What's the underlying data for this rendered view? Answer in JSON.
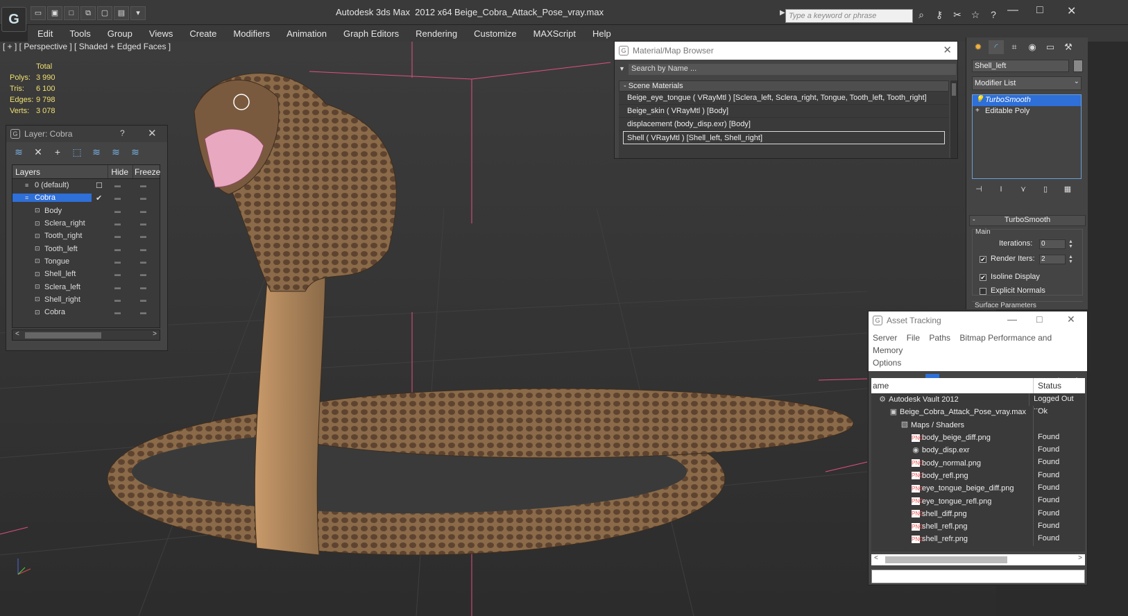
{
  "titlebar": {
    "app_title": "Autodesk 3ds Max  2012 x64",
    "file_name": "Beige_Cobra_Attack_Pose_vray.max",
    "search_placeholder": "Type a keyword or phrase",
    "logo_glyph": "G"
  },
  "menu": [
    "Edit",
    "Tools",
    "Group",
    "Views",
    "Create",
    "Modifiers",
    "Animation",
    "Graph Editors",
    "Rendering",
    "Customize",
    "MAXScript",
    "Help"
  ],
  "viewport": {
    "label": "[ + ] [ Perspective ] [ Shaded + Edged Faces ]",
    "stats_header": "Total",
    "stats": [
      {
        "k": "Polys:",
        "v": "3 990"
      },
      {
        "k": "Tris:",
        "v": "6 100"
      },
      {
        "k": "Edges:",
        "v": "9 798"
      },
      {
        "k": "Verts:",
        "v": "3 078"
      }
    ]
  },
  "layer_window": {
    "title": "Layer: Cobra",
    "help": "?",
    "close": "✕",
    "col_layers": "Layers",
    "col_hide": "Hide",
    "col_freeze": "Freeze",
    "rows": [
      {
        "name": "0 (default)",
        "indent": 0,
        "selected": false,
        "check": "☐"
      },
      {
        "name": "Cobra",
        "indent": 0,
        "selected": true,
        "check": "✔"
      },
      {
        "name": "Body",
        "indent": 1,
        "selected": false,
        "check": ""
      },
      {
        "name": "Sclera_right",
        "indent": 1,
        "selected": false,
        "check": ""
      },
      {
        "name": "Tooth_right",
        "indent": 1,
        "selected": false,
        "check": ""
      },
      {
        "name": "Tooth_left",
        "indent": 1,
        "selected": false,
        "check": ""
      },
      {
        "name": "Tongue",
        "indent": 1,
        "selected": false,
        "check": ""
      },
      {
        "name": "Shell_left",
        "indent": 1,
        "selected": false,
        "check": ""
      },
      {
        "name": "Sclera_left",
        "indent": 1,
        "selected": false,
        "check": ""
      },
      {
        "name": "Shell_right",
        "indent": 1,
        "selected": false,
        "check": ""
      },
      {
        "name": "Cobra",
        "indent": 1,
        "selected": false,
        "check": ""
      }
    ]
  },
  "material_browser": {
    "title": "Material/Map Browser",
    "search": "Search by Name ...",
    "group": "- Scene Materials",
    "items": [
      "Beige_eye_tongue  ( VRayMtl ) [Sclera_left, Sclera_right, Tongue, Tooth_left, Tooth_right]",
      "Beige_skin  ( VRayMtl ) [Body]",
      "displacement (body_disp.exr) [Body]",
      "Shell  ( VRayMtl ) [Shell_left, Shell_right]"
    ],
    "selected_index": 3
  },
  "command_panel": {
    "object_name": "Shell_left",
    "modifier_list": "Modifier List",
    "stack": [
      {
        "label": "TurboSmooth",
        "selected": true,
        "glyph": "💡"
      },
      {
        "label": "Editable Poly",
        "selected": false,
        "glyph": "+"
      }
    ],
    "rollout_title": "TurboSmooth",
    "rollout_toggle": "-",
    "group_main": "Main",
    "iterations_label": "Iterations:",
    "iterations_value": "0",
    "render_iters_label": "Render Iters:",
    "render_iters_value": "2",
    "render_iters_checked": true,
    "isoline_label": "Isoline Display",
    "isoline_checked": true,
    "explicit_normals_label": "Explicit Normals",
    "explicit_normals_checked": false,
    "surface_params": "Surface Parameters"
  },
  "asset_tracking": {
    "title": "Asset Tracking",
    "menu": [
      "Server",
      "File",
      "Paths",
      "Bitmap Performance and Memory",
      "Options"
    ],
    "col_name": "ame",
    "col_status": "Status",
    "rows": [
      {
        "name": "Autodesk Vault 2012",
        "status": "Logged Out ...",
        "indent": 0,
        "icon": "vault-icon"
      },
      {
        "name": "Beige_Cobra_Attack_Pose_vray.max",
        "status": "Ok",
        "indent": 1,
        "icon": "max-file-icon"
      },
      {
        "name": "Maps / Shaders",
        "status": "",
        "indent": 2,
        "icon": "maps-icon"
      },
      {
        "name": "body_beige_diff.png",
        "status": "Found",
        "indent": 3,
        "icon": "png-icon"
      },
      {
        "name": "body_disp.exr",
        "status": "Found",
        "indent": 3,
        "icon": "exr-icon"
      },
      {
        "name": "body_normal.png",
        "status": "Found",
        "indent": 3,
        "icon": "png-icon"
      },
      {
        "name": "body_refl.png",
        "status": "Found",
        "indent": 3,
        "icon": "png-icon"
      },
      {
        "name": "eye_tongue_beige_diff.png",
        "status": "Found",
        "indent": 3,
        "icon": "png-icon"
      },
      {
        "name": "eye_tongue_refl.png",
        "status": "Found",
        "indent": 3,
        "icon": "png-icon"
      },
      {
        "name": "shell_diff.png",
        "status": "Found",
        "indent": 3,
        "icon": "png-icon"
      },
      {
        "name": "shell_refl.png",
        "status": "Found",
        "indent": 3,
        "icon": "png-icon"
      },
      {
        "name": "shell_refr.png",
        "status": "Found",
        "indent": 3,
        "icon": "png-icon"
      }
    ]
  },
  "colors": {
    "selection": "#2e6fd8",
    "stats_text": "#f0e070",
    "snake_body": "#8a6a48",
    "gizmo_lines": "#e05080"
  }
}
